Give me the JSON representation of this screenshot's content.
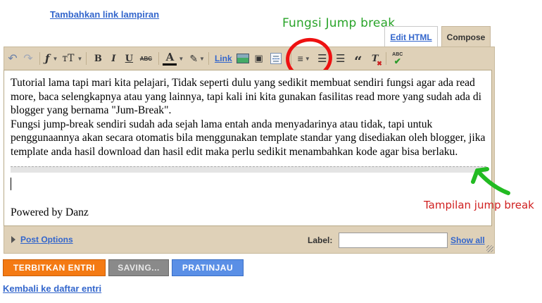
{
  "top": {
    "attach_link": "Tambahkan link lampiran"
  },
  "annotations": {
    "jump_break_function": "Fungsi Jump break",
    "jump_break_view": "Tampilan jump break"
  },
  "mode_tabs": {
    "edit_html": "Edit HTML",
    "compose": "Compose"
  },
  "toolbar": {
    "font_glyph": "ƒ",
    "size_glyph": "тT",
    "bold": "B",
    "italic": "I",
    "underline": "U",
    "strike": "ABC",
    "text_color": "A",
    "link": "Link",
    "quote": "“",
    "clear_format": "T",
    "spell": "ABC"
  },
  "editor": {
    "paragraph1": "Tutorial lama tapi mari kita pelajari, Tidak seperti dulu yang sedikit membuat sendiri fungsi agar ada read more, baca selengkapnya atau yang lainnya, tapi kali ini kita gunakan fasilitas read more yang sudah ada di blogger yang bernama \"Jum-Break\".",
    "paragraph2": "Fungsi jump-break sendiri sudah ada sejah lama entah anda menyadarinya atau tidak, tapi untuk penggunaannya akan secara otomatis bila menggunakan template standar yang disediakan oleh blogger, jika template anda hasil download dan hasil edit maka perlu sedikit menambahkan kode agar bisa berlaku.",
    "signature": "Powered by Danz"
  },
  "options": {
    "post_options": "Post Options",
    "label": "Label:",
    "label_value": "",
    "show_all": "Show all"
  },
  "buttons": {
    "publish": "TERBITKAN ENTRI",
    "saving": "SAVING...",
    "preview": "PRATINJAU"
  },
  "back_link": "Kembali ke daftar entri",
  "colors": {
    "link": "#3366cc",
    "frame": "#dfd1b8",
    "publish": "#f47a13",
    "saving": "#8a8a8a",
    "preview": "#5a8fe6",
    "annotation_green": "#2aa42a",
    "annotation_red": "#d02020"
  },
  "icons": [
    "undo-icon",
    "redo-icon",
    "font-icon",
    "text-size-icon",
    "text-color-icon",
    "highlight-icon",
    "image-icon",
    "video-icon",
    "jump-break-icon",
    "align-icon",
    "numbered-list-icon",
    "bullet-list-icon",
    "quote-icon",
    "clear-format-icon",
    "spellcheck-icon"
  ]
}
